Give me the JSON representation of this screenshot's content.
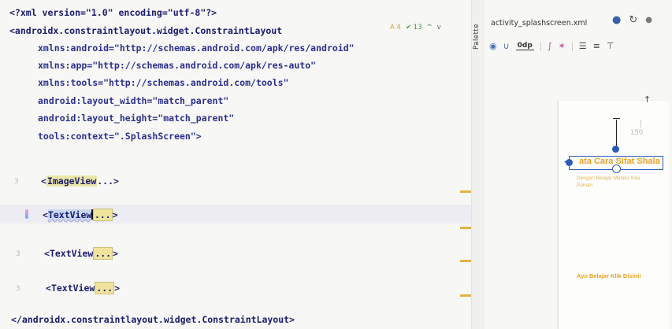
{
  "editor": {
    "lines": {
      "xml_decl": "<?xml version=\"1.0\" encoding=\"utf-8\"?>",
      "root_open": "<androidx.constraintlayout.widget.ConstraintLayout",
      "ns_android": "xmlns:android=\"http://schemas.android.com/apk/res/android\"",
      "ns_app": "xmlns:app=\"http://schemas.android.com/apk/res-auto\"",
      "ns_tools": "xmlns:tools=\"http://schemas.android.com/tools\"",
      "layout_width": "android:layout_width=\"match_parent\"",
      "layout_height": "android:layout_height=\"match_parent\"",
      "tools_context": "tools:context=\".SplashScreen\">",
      "root_close": "</androidx.constraintlayout.widget.ConstraintLayout>"
    },
    "folded": [
      {
        "open": "<",
        "tag": "ImageView",
        "dots": "...",
        "close": ">"
      },
      {
        "open": "<",
        "tag": "TextView",
        "dots": "...",
        "close": ">"
      },
      {
        "open": "<",
        "tag": "TextView",
        "dots": "...",
        "close": ">"
      },
      {
        "open": "<",
        "tag": "TextView",
        "dots": "...",
        "close": ">"
      }
    ],
    "gutter_numbers": [
      "3",
      "3",
      "3"
    ],
    "inspection": {
      "warnings": "A 4",
      "ok": "✔ 13",
      "up": "^",
      "down": "v"
    }
  },
  "panel": {
    "palette_label": "Palette",
    "file_tab": "activity_splashscreen.xml",
    "toolbar_badge": "0dp",
    "preview": {
      "dimension": "150",
      "title": "ata Cara Sifat Shala",
      "subtitle": "Dengan Belajar Melalui Kita Paham",
      "bottom": "Ayo Belajar Klik Disini!"
    }
  },
  "colors": {
    "accent_orange": "#e8a322",
    "selection_blue": "#2f5bb5",
    "tag_color": "#1a1a6e",
    "value_green": "#1f7a1f"
  }
}
